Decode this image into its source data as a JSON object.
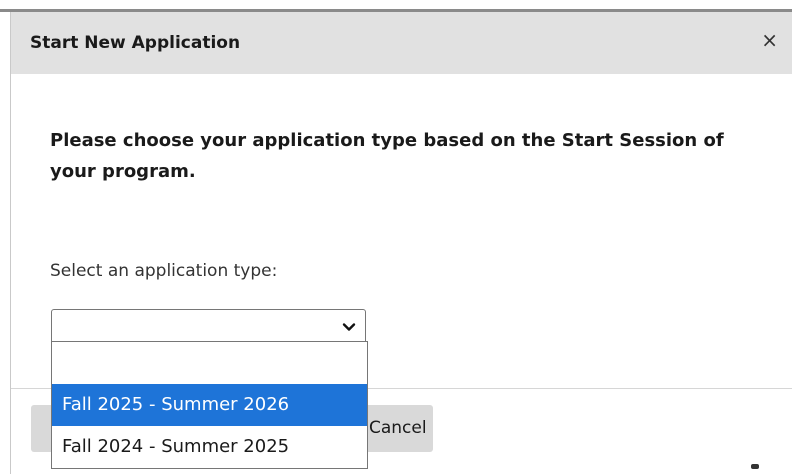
{
  "dialog": {
    "title": "Start New Application",
    "close_glyph": "×",
    "instructions": "Please choose your application type based on the Start Session of your program.",
    "select_label": "Select an application type:",
    "select_value": "",
    "options": [
      {
        "label": ""
      },
      {
        "label": "Fall 2025 - Summer 2026",
        "highlighted": true
      },
      {
        "label": "Fall 2024 - Summer 2025"
      }
    ],
    "cancel_label": "Cancel"
  },
  "colors": {
    "header_bg": "#e1e1e1",
    "highlight": "#1e74d8",
    "button_bg": "#d9d9d9"
  },
  "icons": {
    "close": "close-icon",
    "dropdown": "chevron-down-icon"
  }
}
